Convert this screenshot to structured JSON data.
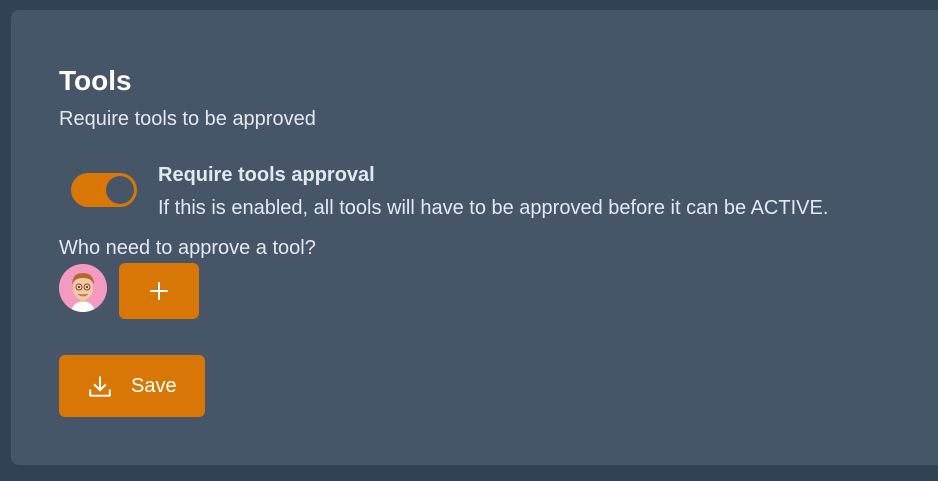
{
  "section": {
    "title": "Tools",
    "subtitle": "Require tools to be approved"
  },
  "approval_toggle": {
    "label": "Require tools approval",
    "description": "If this is enabled, all tools will have to be approved before it can be ACTIVE.",
    "enabled": true
  },
  "approvers": {
    "label": "Who need to approve a tool?",
    "users": [
      {
        "avatar_icon": "memoji-avatar-icon"
      }
    ],
    "add_icon": "plus-icon"
  },
  "actions": {
    "save_label": "Save",
    "save_icon": "download-icon"
  },
  "colors": {
    "page_background": "#334155",
    "card_background": "#475569",
    "accent": "#d97706",
    "text_primary": "#ffffff",
    "text_secondary": "#e2e8f0",
    "avatar_background": "#f49ac1"
  }
}
